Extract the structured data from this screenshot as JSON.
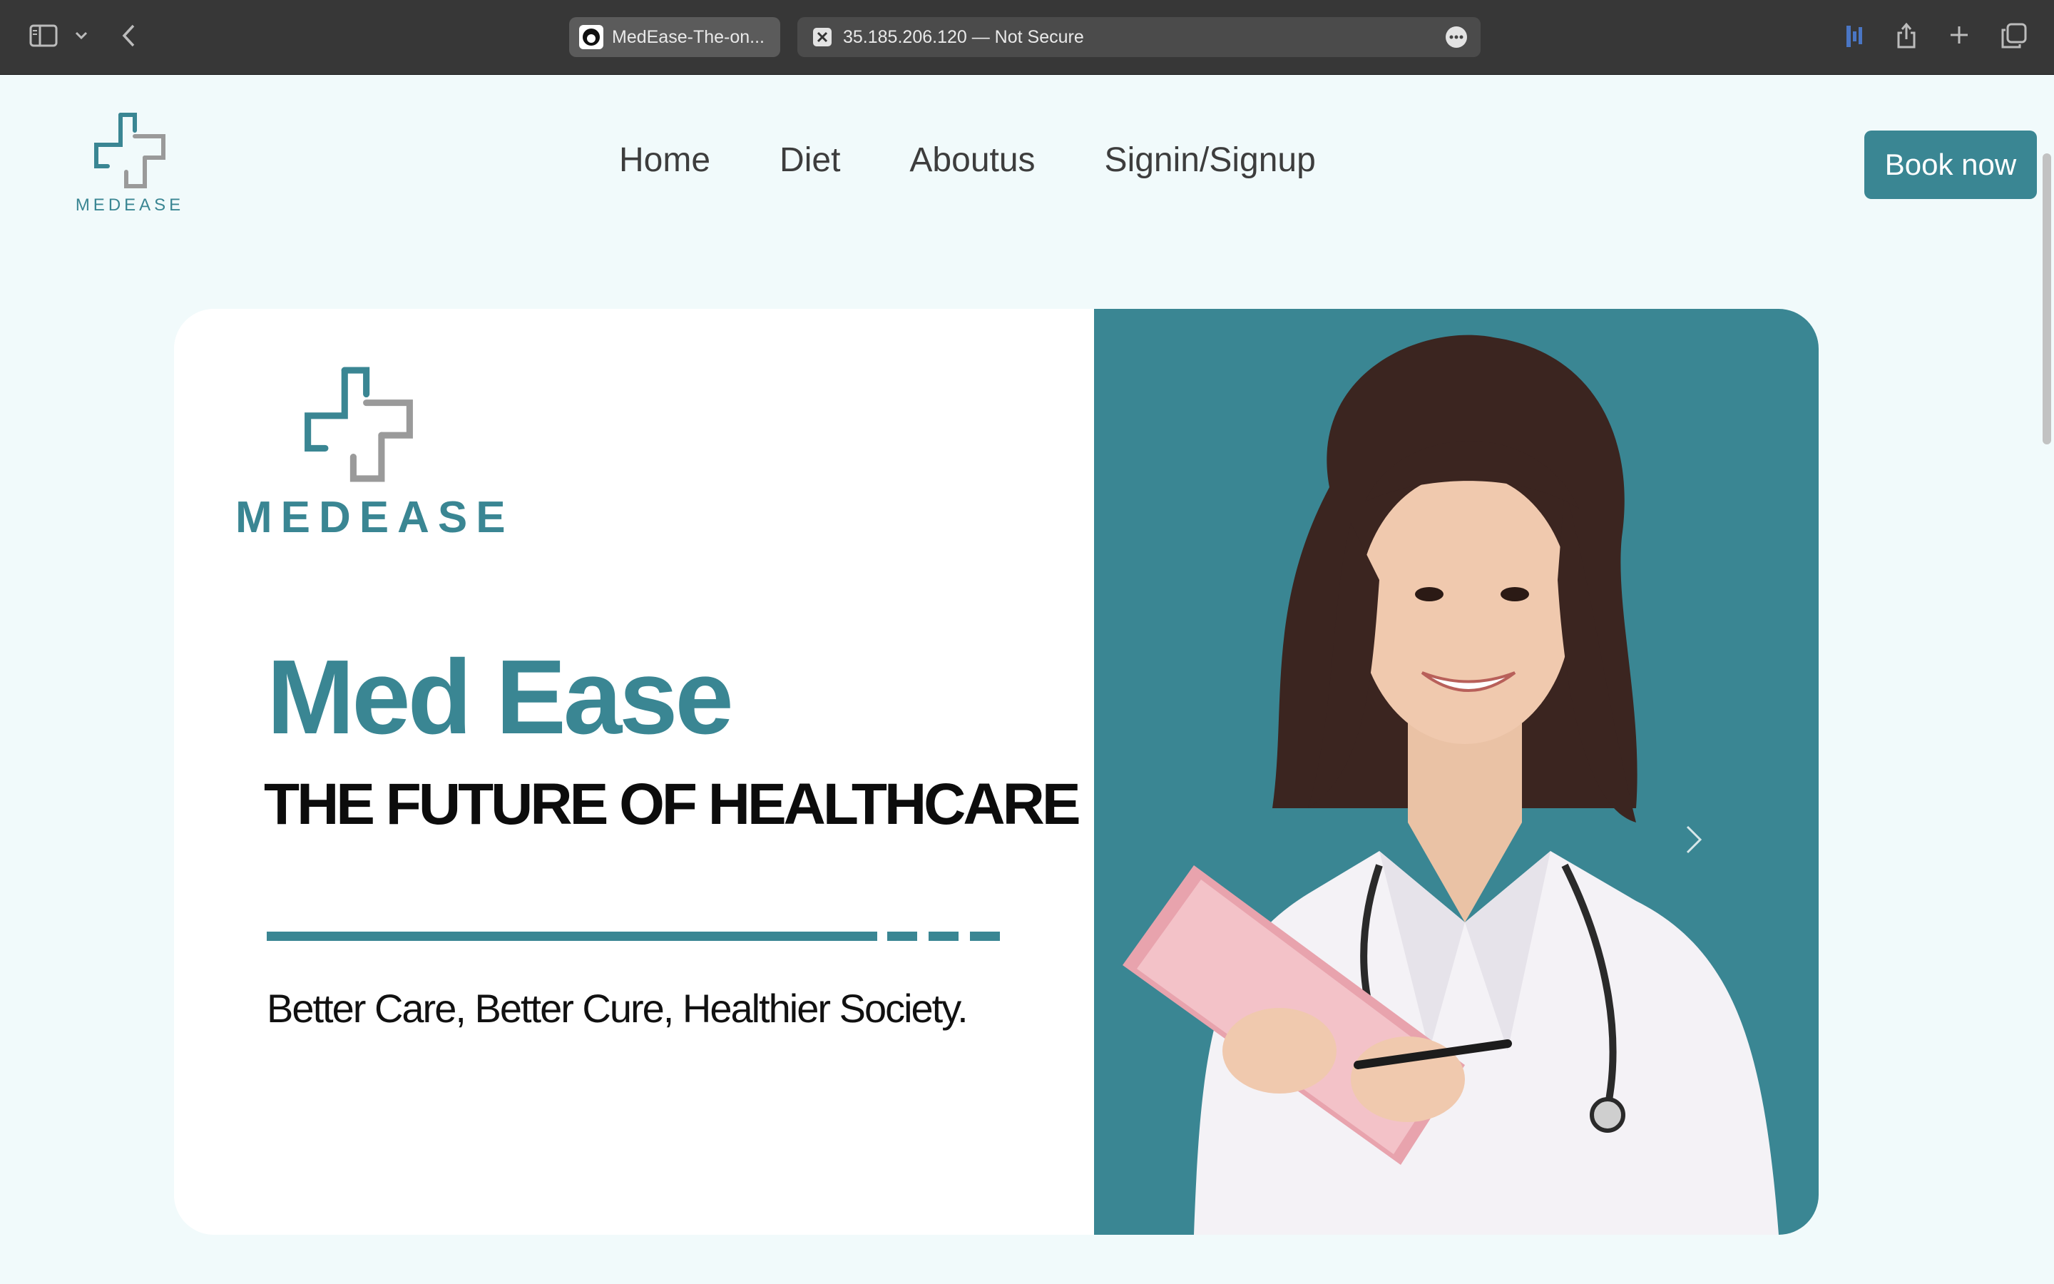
{
  "browser": {
    "tab1_title": "MedEase-The-on...",
    "tab2_title": "35.185.206.120 — Not Secure"
  },
  "header": {
    "logo_text": "MEDEASE",
    "nav": [
      "Home",
      "Diet",
      "Aboutus",
      "Signin/Signup"
    ],
    "cta_label": "Book now"
  },
  "hero": {
    "logo_text": "MEDEASE",
    "title": "Med Ease",
    "subtitle": "THE FUTURE OF HEALTHCARE",
    "tagline": "Better Care, Better Cure, Healthier Society."
  },
  "colors": {
    "accent": "#3a8693",
    "page_bg": "#f1fafb",
    "chrome_bg": "#373737"
  },
  "icons": [
    "sidebar-icon",
    "chevron-down-icon",
    "back-icon",
    "github-icon",
    "close-icon",
    "more-icon",
    "extension-icon",
    "share-icon",
    "plus-icon",
    "tabs-icon",
    "chevron-right-icon"
  ]
}
